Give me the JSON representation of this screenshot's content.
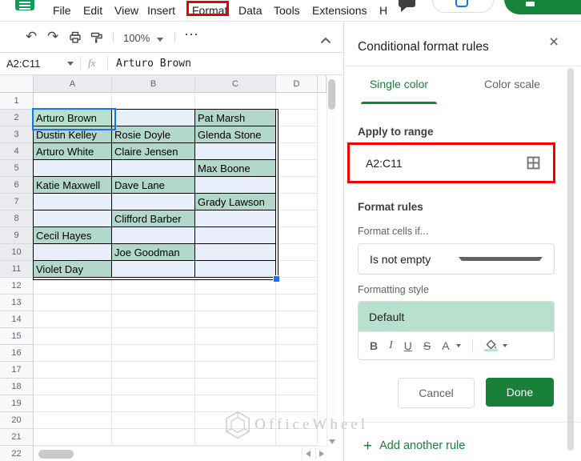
{
  "header": {
    "menu_items": [
      "File",
      "Edit",
      "View",
      "Insert",
      "Format",
      "Data",
      "Tools",
      "Extensions",
      "H"
    ],
    "highlighted_menu": "Format"
  },
  "toolbar": {
    "zoom_level": "100%"
  },
  "formula_bar": {
    "name_box_value": "A2:C11",
    "fx_label": "fx",
    "cell_content": "Arturo Brown"
  },
  "grid": {
    "columns": [
      "A",
      "B",
      "C",
      "D"
    ],
    "visible_rows": 22,
    "selected_range": "A2:C11",
    "active_cell": "A2",
    "rows": [
      {
        "row": 2,
        "cells": [
          "Arturo Brown",
          "",
          "Pat Marsh"
        ]
      },
      {
        "row": 3,
        "cells": [
          "Dustin Kelley",
          "Rosie Doyle",
          "Glenda Stone"
        ]
      },
      {
        "row": 4,
        "cells": [
          "Arturo White",
          "Claire Jensen",
          ""
        ]
      },
      {
        "row": 5,
        "cells": [
          "",
          "",
          "Max Boone"
        ]
      },
      {
        "row": 6,
        "cells": [
          "Katie Maxwell",
          "Dave Lane",
          ""
        ]
      },
      {
        "row": 7,
        "cells": [
          "",
          "",
          "Grady Lawson"
        ]
      },
      {
        "row": 8,
        "cells": [
          "",
          "Clifford Barber",
          ""
        ]
      },
      {
        "row": 9,
        "cells": [
          "Cecil Hayes",
          "",
          ""
        ]
      },
      {
        "row": 10,
        "cells": [
          "",
          "Joe Goodman",
          ""
        ]
      },
      {
        "row": 11,
        "cells": [
          "Violet Day",
          "",
          ""
        ]
      }
    ]
  },
  "panel": {
    "title": "Conditional format rules",
    "tabs": [
      {
        "label": "Single color",
        "active": true
      },
      {
        "label": "Color scale",
        "active": false
      }
    ],
    "apply_to_range_label": "Apply to range",
    "range_value": "A2:C11",
    "format_rules_label": "Format rules",
    "format_cells_if_label": "Format cells if...",
    "condition_value": "Is not empty",
    "formatting_style_label": "Formatting style",
    "style_preview_text": "Default",
    "cancel_label": "Cancel",
    "done_label": "Done",
    "add_rule_label": "Add another rule"
  },
  "watermark": {
    "text": "OfficeWheel"
  },
  "icons": {
    "close": "×",
    "more": "⋯",
    "undo": "↶",
    "redo": "↷",
    "bold": "B",
    "italic": "I",
    "underline": "U",
    "strikethrough": "S",
    "text_color": "A",
    "plus": "+"
  },
  "colors": {
    "accent_green": "#188038",
    "annotation_red": "#ee0000",
    "filled_cell_teal": "#b2d8cc",
    "active_cell_fill": "#b7e1cd",
    "empty_range_cell_blue": "#e8effb",
    "selection_blue": "#1a73e8",
    "style_preview_green": "#b7e1cd"
  }
}
